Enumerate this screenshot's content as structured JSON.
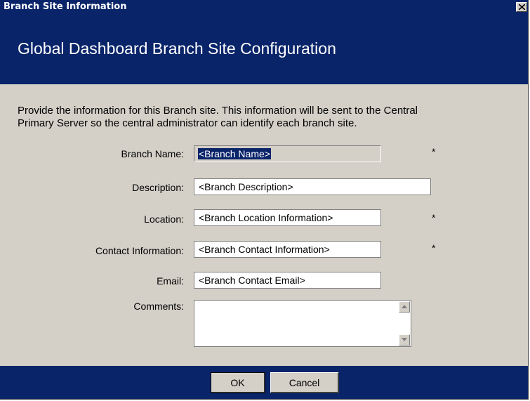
{
  "window": {
    "title": "Branch Site Information",
    "close_icon": "close-icon"
  },
  "header": {
    "title": "Global Dashboard Branch Site Configuration"
  },
  "intro": {
    "line1": "Provide the information for this Branch site. This information will be sent to the Central",
    "line2": "Primary Server so the central administrator can identify each branch site."
  },
  "form": {
    "branch_name": {
      "label": "Branch Name:",
      "value": "<Branch Name>",
      "required": "*"
    },
    "description": {
      "label": "Description:",
      "value": "<Branch Description>"
    },
    "location": {
      "label": "Location:",
      "value": "<Branch Location Information>",
      "required": "*"
    },
    "contact": {
      "label": "Contact Information:",
      "value": "<Branch Contact Information>",
      "required": "*"
    },
    "email": {
      "label": "Email:",
      "value": "<Branch Contact Email>"
    },
    "comments": {
      "label": "Comments:",
      "value": ""
    }
  },
  "buttons": {
    "ok": "OK",
    "cancel": "Cancel"
  },
  "colors": {
    "titlebar": "#0a246a",
    "dialog_face": "#d4d0c8",
    "selection": "#0a246a"
  }
}
